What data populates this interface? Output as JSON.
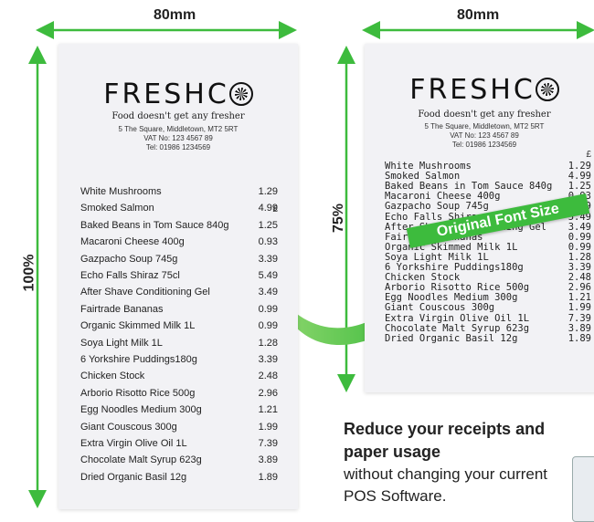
{
  "left_receipt": {
    "width_label": "80mm",
    "height_label": "100%",
    "brand": "FRESHC",
    "tagline": "Food doesn't get any fresher",
    "address": "5 The Square, Middletown, MT2 5RT",
    "vat": "VAT No: 123 4567 89",
    "tel": "Tel: 01986 1234569",
    "currency": "£"
  },
  "right_receipt": {
    "width_label": "80mm",
    "height_label": "75%",
    "brand": "FRESHC",
    "tagline": "Food doesn't get any fresher",
    "address": "5 The Square, Middletown, MT2 5RT",
    "vat": "VAT No: 123 4567 89",
    "tel": "Tel: 01986 1234569",
    "currency": "£",
    "banner": "Original Font Size"
  },
  "items": [
    {
      "name": "White Mushrooms",
      "price": "1.29"
    },
    {
      "name": "Smoked Salmon",
      "price": "4.99"
    },
    {
      "name": "Baked Beans in Tom Sauce 840g",
      "price": "1.25"
    },
    {
      "name": "Macaroni Cheese 400g",
      "price": "0.93"
    },
    {
      "name": "Gazpacho Soup 745g",
      "price": "3.39"
    },
    {
      "name": "Echo Falls Shiraz 75cl",
      "price": "5.49"
    },
    {
      "name": "After Shave Conditioning Gel",
      "price": "3.49"
    },
    {
      "name": "Fairtrade Bananas",
      "price": "0.99"
    },
    {
      "name": "Organic Skimmed Milk 1L",
      "price": "0.99"
    },
    {
      "name": "Soya Light Milk 1L",
      "price": "1.28"
    },
    {
      "name": "6 Yorkshire Puddings180g",
      "price": "3.39"
    },
    {
      "name": "Chicken Stock",
      "price": "2.48"
    },
    {
      "name": "Arborio Risotto Rice 500g",
      "price": "2.96"
    },
    {
      "name": "Egg Noodles Medium 300g",
      "price": "1.21"
    },
    {
      "name": "Giant Couscous 300g",
      "price": "1.99"
    },
    {
      "name": "Extra Virgin Olive Oil 1L",
      "price": "7.39"
    },
    {
      "name": "Chocolate Malt Syrup 623g",
      "price": "3.89"
    },
    {
      "name": "Dried Organic Basil 12g",
      "price": "1.89"
    }
  ],
  "promo": {
    "title": "Reduce your receipts and paper usage",
    "body": "without changing your current POS Software."
  },
  "colors": {
    "arrow_green": "#3dbb3d",
    "receipt_bg": "#f2f2f5"
  }
}
